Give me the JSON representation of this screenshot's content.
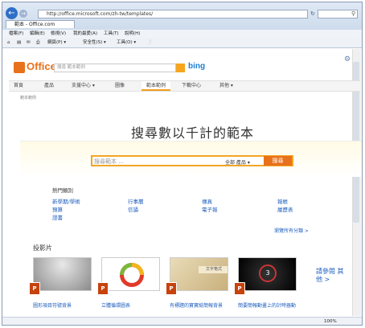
{
  "browser": {
    "address": "http://office.microsoft.com/zh-tw/templates/",
    "tab_title": "範本 - Office.com",
    "menu": [
      "檔案(F)",
      "編輯(E)",
      "檢視(V)",
      "我的最愛(A)",
      "工具(T)",
      "說明(H)"
    ],
    "commands": [
      "網頁(P) ▾",
      "安全性(S) ▾",
      "工具(O) ▾"
    ],
    "zoom": "100%"
  },
  "site": {
    "logo_text": "Office",
    "search_placeholder": "搜尋 範本範例",
    "bing": "bing",
    "nav": [
      "首頁",
      "產品",
      "支援中心 ▾",
      "圖像",
      "範本範例",
      "下載中心",
      "其他 ▾"
    ],
    "active_nav_index": 4,
    "breadcrumb": "範本範例"
  },
  "hero": {
    "title": "搜尋數以千計的範本",
    "search_placeholder": "搜尋範本 ...",
    "scope": "全部 產品  ▾",
    "button": "搜尋"
  },
  "categories": {
    "title": "熱門類別",
    "items": [
      "新學期/學術",
      "預算",
      "證書",
      "行事曆",
      "信誦",
      "傳真",
      "電子報",
      "報帳",
      "履歷表"
    ],
    "browse_all": "瀏覽所有分類 >"
  },
  "presentations": {
    "title": "投影片",
    "items": [
      {
        "label": "圖形項目符號背景"
      },
      {
        "label": "立體循環圖表"
      },
      {
        "label": "有標題的寶寶紙簡報背景"
      },
      {
        "label": "簡要簡報動畫上的計時器動"
      }
    ],
    "more": "請參閱 其他 >"
  }
}
